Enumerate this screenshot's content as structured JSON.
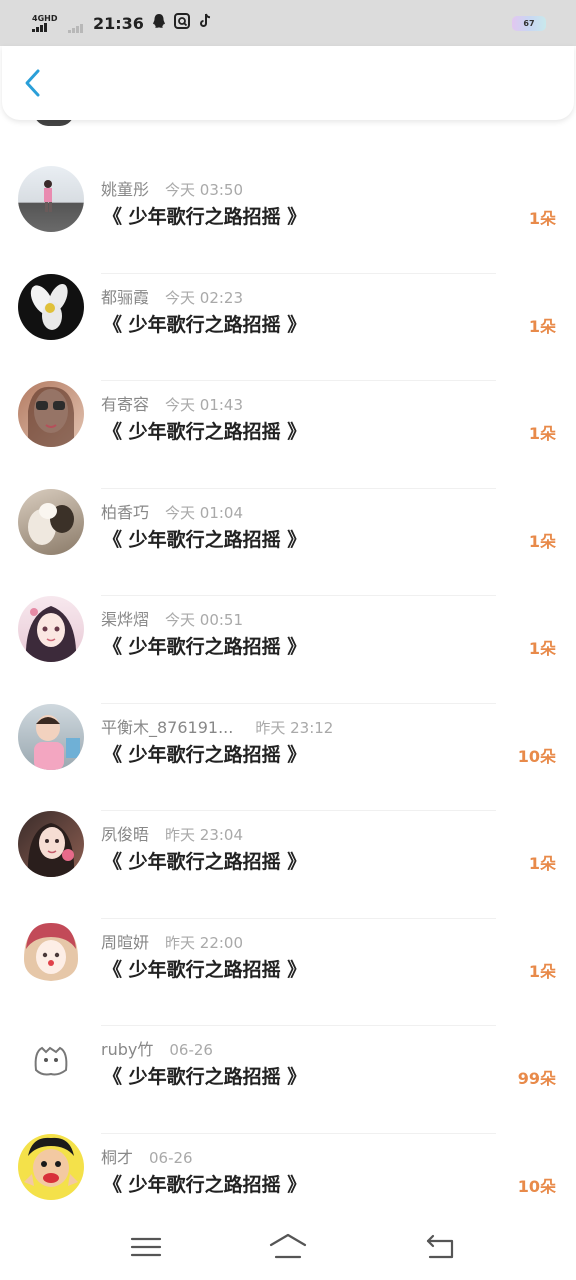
{
  "status_bar": {
    "network": "4GHD",
    "time": "21:36",
    "battery": "67",
    "icons": [
      "signal-icon",
      "qq-icon",
      "camera-app-icon",
      "tiktok-icon"
    ]
  },
  "header": {
    "back_icon": "chevron-left-icon",
    "accent_color": "#2a9fd8"
  },
  "gifts": [
    {
      "name": "姚童彤",
      "time": "今天 03:50",
      "message": "《 少年歌行之路招摇 》",
      "count": "1朵"
    },
    {
      "name": "都骊霞",
      "time": "今天 02:23",
      "message": "《 少年歌行之路招摇 》",
      "count": "1朵"
    },
    {
      "name": "有寄容",
      "time": "今天 01:43",
      "message": "《 少年歌行之路招摇 》",
      "count": "1朵"
    },
    {
      "name": "柏香巧",
      "time": "今天 01:04",
      "message": "《 少年歌行之路招摇 》",
      "count": "1朵"
    },
    {
      "name": "渠烨熠",
      "time": "今天 00:51",
      "message": "《 少年歌行之路招摇 》",
      "count": "1朵"
    },
    {
      "name": "平衡木_876191...",
      "time": "昨天 23:12",
      "message": "《 少年歌行之路招摇 》",
      "count": "10朵"
    },
    {
      "name": "夙俊晤",
      "time": "昨天 23:04",
      "message": "《 少年歌行之路招摇 》",
      "count": "1朵"
    },
    {
      "name": "周暄妍",
      "time": "昨天 22:00",
      "message": "《 少年歌行之路招摇 》",
      "count": "1朵"
    },
    {
      "name": "ruby竹",
      "time": "06-26",
      "message": "《 少年歌行之路招摇 》",
      "count": "99朵"
    },
    {
      "name": "桐才",
      "time": "06-26",
      "message": "《 少年歌行之路招摇 》",
      "count": "10朵"
    }
  ],
  "colors": {
    "count": "#e88a4a",
    "name": "#888888",
    "time": "#a9a9a9"
  },
  "bottom_nav": {
    "icons": [
      "menu-icon",
      "home-icon",
      "back-icon"
    ]
  }
}
